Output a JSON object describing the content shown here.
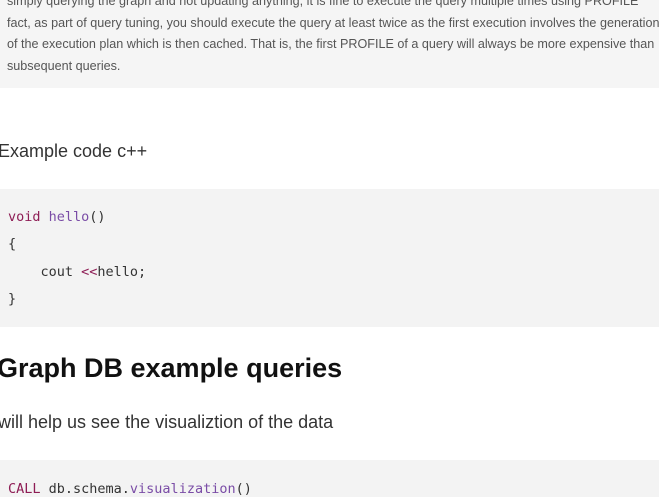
{
  "note": {
    "lines": [
      "simply querying the graph and not updating anything, it is fine to execute the query multiple times using PROFILE",
      "fact, as part of query tuning, you should execute the query at least twice as the first execution involves the generation",
      "of the execution plan which is then cached. That is, the first PROFILE of a query will always be more expensive than",
      "subsequent queries."
    ]
  },
  "example_label": "Example code c++",
  "cpp_code": {
    "line1": {
      "keyword": "void",
      "space": " ",
      "function": "hello",
      "rest": "()"
    },
    "line2": "{",
    "line3": {
      "indent": "    cout ",
      "operator": "<<",
      "rest": "hello;"
    },
    "line4": "}"
  },
  "heading": "Graph DB example queries",
  "subtext": "will help us see the visualiztion of the data",
  "cypher_code": {
    "keyword": "CALL",
    "middle": " db.schema.",
    "function": "visualization",
    "rest": "()"
  }
}
